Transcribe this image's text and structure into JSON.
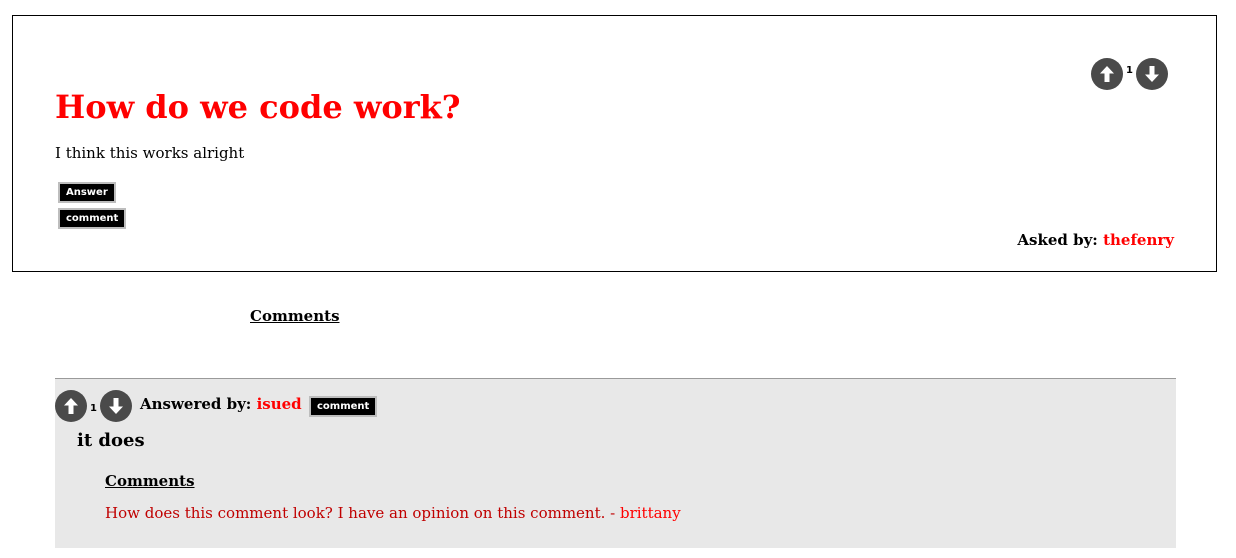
{
  "question": {
    "title": "How do we code work?",
    "body": "I think this works alright",
    "answer_button": "Answer",
    "comment_button": "comment",
    "asked_by_label": "Asked by:",
    "asked_by_user": "thefenry",
    "vote_count": "1"
  },
  "comments_link": "Comments",
  "answer": {
    "vote_count": "1",
    "answered_by_label": "Answered by:",
    "answered_by_user": "isued",
    "comment_button": "comment",
    "body": "it does",
    "comments_heading": "Comments",
    "comments": [
      {
        "text": "How does this comment look? I have an opinion on this comment. - ",
        "author": "brittany"
      }
    ]
  },
  "colors": {
    "title_red": "#ff0000",
    "comment_red": "#c00000",
    "answer_bg": "#e8e8e8",
    "vote_circle": "#4a4a4a"
  },
  "icons": {
    "upvote": "arrow-up-icon",
    "downvote": "arrow-down-icon"
  }
}
